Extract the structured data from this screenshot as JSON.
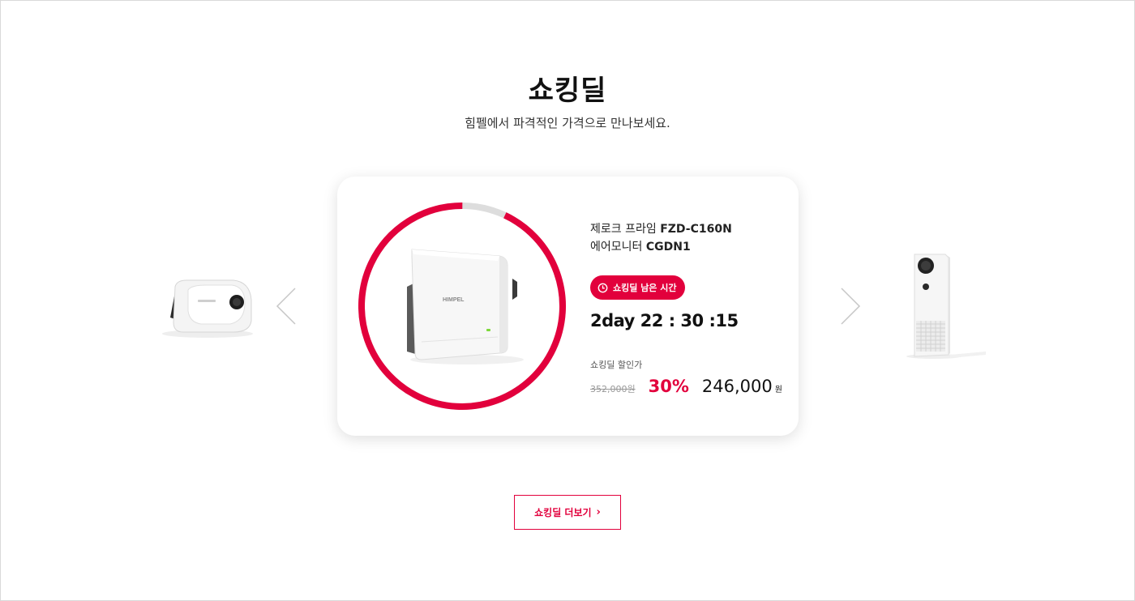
{
  "section": {
    "title": "쇼킹딜",
    "subtitle": "힘펠에서 파격적인 가격으로 만나보세요."
  },
  "product": {
    "name_prefix_1": "제로크 프라임 ",
    "name_model_1": "FZD-C160N",
    "name_prefix_2": "에어모니터 ",
    "name_model_2": "CGDN1",
    "brand_mark": "HIMPEL",
    "badge_label": "쇼킹딜 남은 시간",
    "timer": "2day 22 : 30 :15",
    "price_label": "쇼킹딜 할인가",
    "original_price": "352,000원",
    "discount_rate": "30%",
    "sale_price": "246,000",
    "currency": "원",
    "time_remaining_fraction": 0.93
  },
  "navigation": {
    "prev_icon": "chevron-left-icon",
    "next_icon": "chevron-right-icon"
  },
  "more_button": {
    "label": "쇼킹딜 더보기",
    "icon": "chevron-right-icon"
  },
  "colors": {
    "accent": "#e2003c",
    "ring_track": "#dddddd"
  }
}
